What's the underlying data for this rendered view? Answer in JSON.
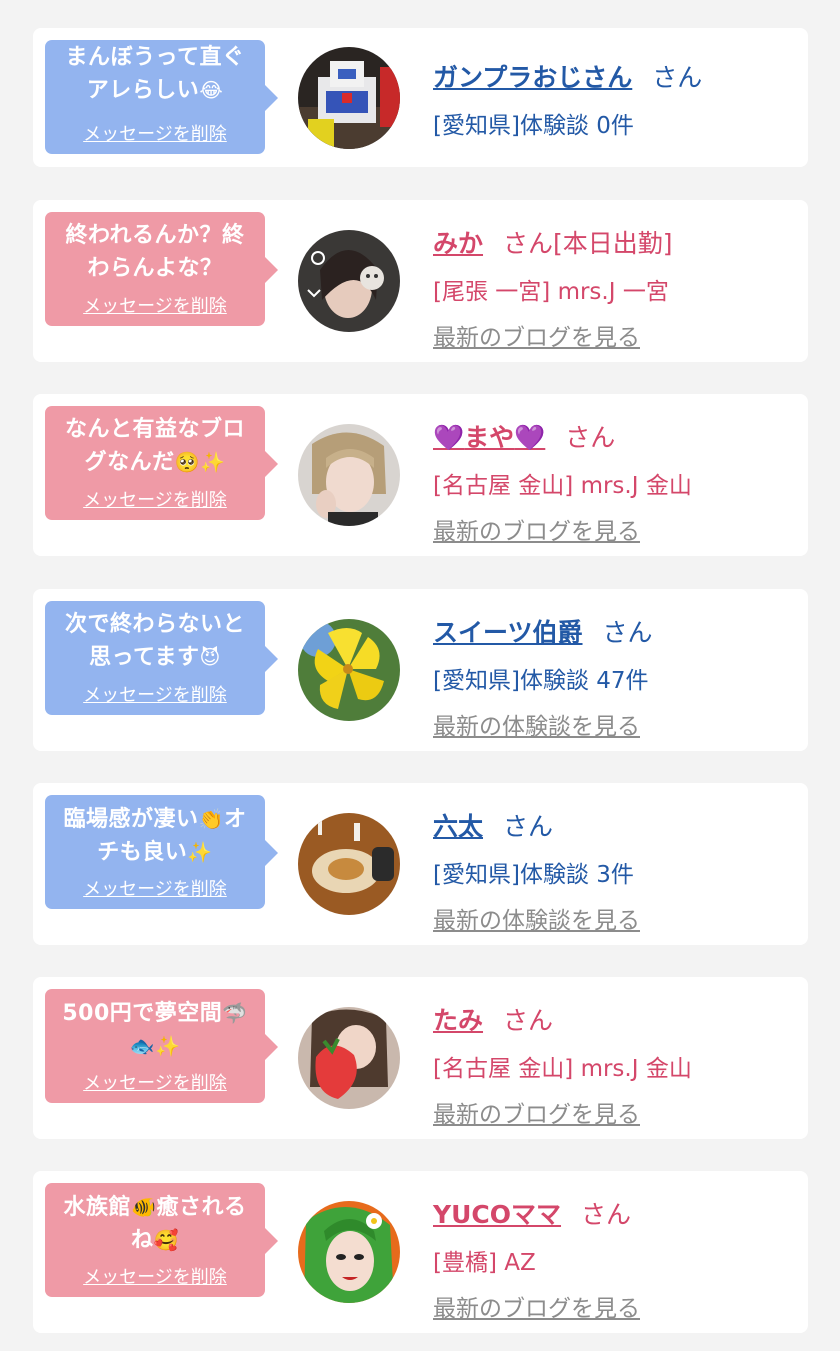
{
  "delete_label": "メッセージを削除",
  "colors": {
    "blue_bubble": "#93b4ef",
    "pink_bubble": "#ef9aa6",
    "blue_text": "#2359a6",
    "pink_text": "#d4476a",
    "link_gray": "#8c8c8c"
  },
  "cards": [
    {
      "message_line1": "まんぼうって直ぐ",
      "message_line2": "アレらしい",
      "message_emoji": "😂",
      "user_name": "ガンプラおじさん",
      "suffix": "さん",
      "info": "[愛知県]体験談 0件",
      "link": ""
    },
    {
      "message_line1": "終われるんか？終",
      "message_line2": "わらんよな？",
      "message_emoji": "",
      "user_name": "みか",
      "suffix": "さん[本日出勤]",
      "info": "[尾張 一宮] mrs.J 一宮",
      "link": "最新のブログを見る"
    },
    {
      "message_line1": "なんと有益なブロ",
      "message_line2": "グなんだ",
      "message_emoji": "🥺✨",
      "user_name_heart_left": "💜",
      "user_name": "まや",
      "user_name_heart_right": "💜",
      "suffix": "さん",
      "info": "[名古屋 金山] mrs.J 金山",
      "link": "最新のブログを見る"
    },
    {
      "message_line1": "次で終わらないと",
      "message_line2": "思ってます",
      "message_emoji": "😈",
      "user_name": "スイーツ伯爵",
      "suffix": "さん",
      "info": "[愛知県]体験談 47件",
      "link": "最新の体験談を見る"
    },
    {
      "message_line1": "臨場感が凄い",
      "message_emoji_mid": "👏",
      "message_line1_end": "オ",
      "message_line2": "チも良い",
      "message_emoji": "✨",
      "user_name": "六太",
      "suffix": "さん",
      "info": "[愛知県]体験談 3件",
      "link": "最新の体験談を見る"
    },
    {
      "message_line1": "500円で夢空間",
      "message_emoji_mid": "🦈",
      "message_line2": "",
      "message_emoji": "🐟✨",
      "user_name": "たみ",
      "suffix": "さん",
      "info": "[名古屋 金山] mrs.J 金山",
      "link": "最新のブログを見る"
    },
    {
      "message_line1": "水族館",
      "message_emoji_mid": "🐠",
      "message_line1_end": "癒される",
      "message_line2": "ね",
      "message_emoji": "🥰",
      "user_name": "YUCOママ",
      "suffix": "さん",
      "info": "[豊橋] AZ",
      "link": "最新のブログを見る"
    }
  ]
}
